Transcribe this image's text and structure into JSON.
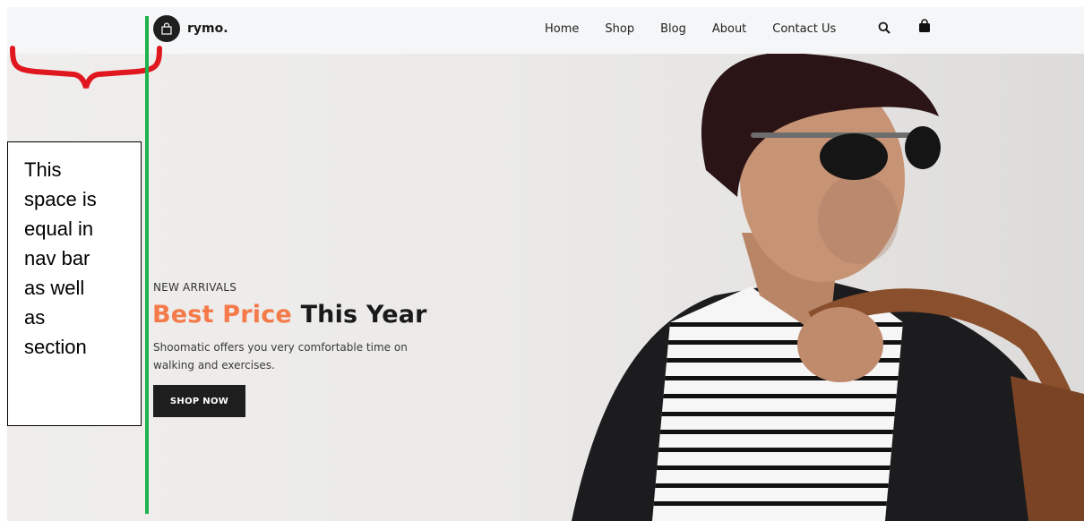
{
  "brand": {
    "name": "rymo.",
    "logo_icon": "shopping-bag-icon"
  },
  "nav": {
    "links": [
      "Home",
      "Shop",
      "Blog",
      "About",
      "Contact Us"
    ],
    "search_icon": "search-icon",
    "cart_icon": "bag-icon"
  },
  "hero": {
    "eyebrow": "NEW ARRIVALS",
    "headline_accent": "Best Price",
    "headline_rest": "This Year",
    "subtext": "Shoomatic offers you very comfortable time on walking and exercises.",
    "cta": "SHOP NOW",
    "accent_color": "#f47a4a"
  },
  "annotation": {
    "text": "This\nspace is\nequal in\nnav bar\nas well\nas\nsection",
    "line_color": "#1db24b",
    "brace_color": "#e0171e"
  }
}
